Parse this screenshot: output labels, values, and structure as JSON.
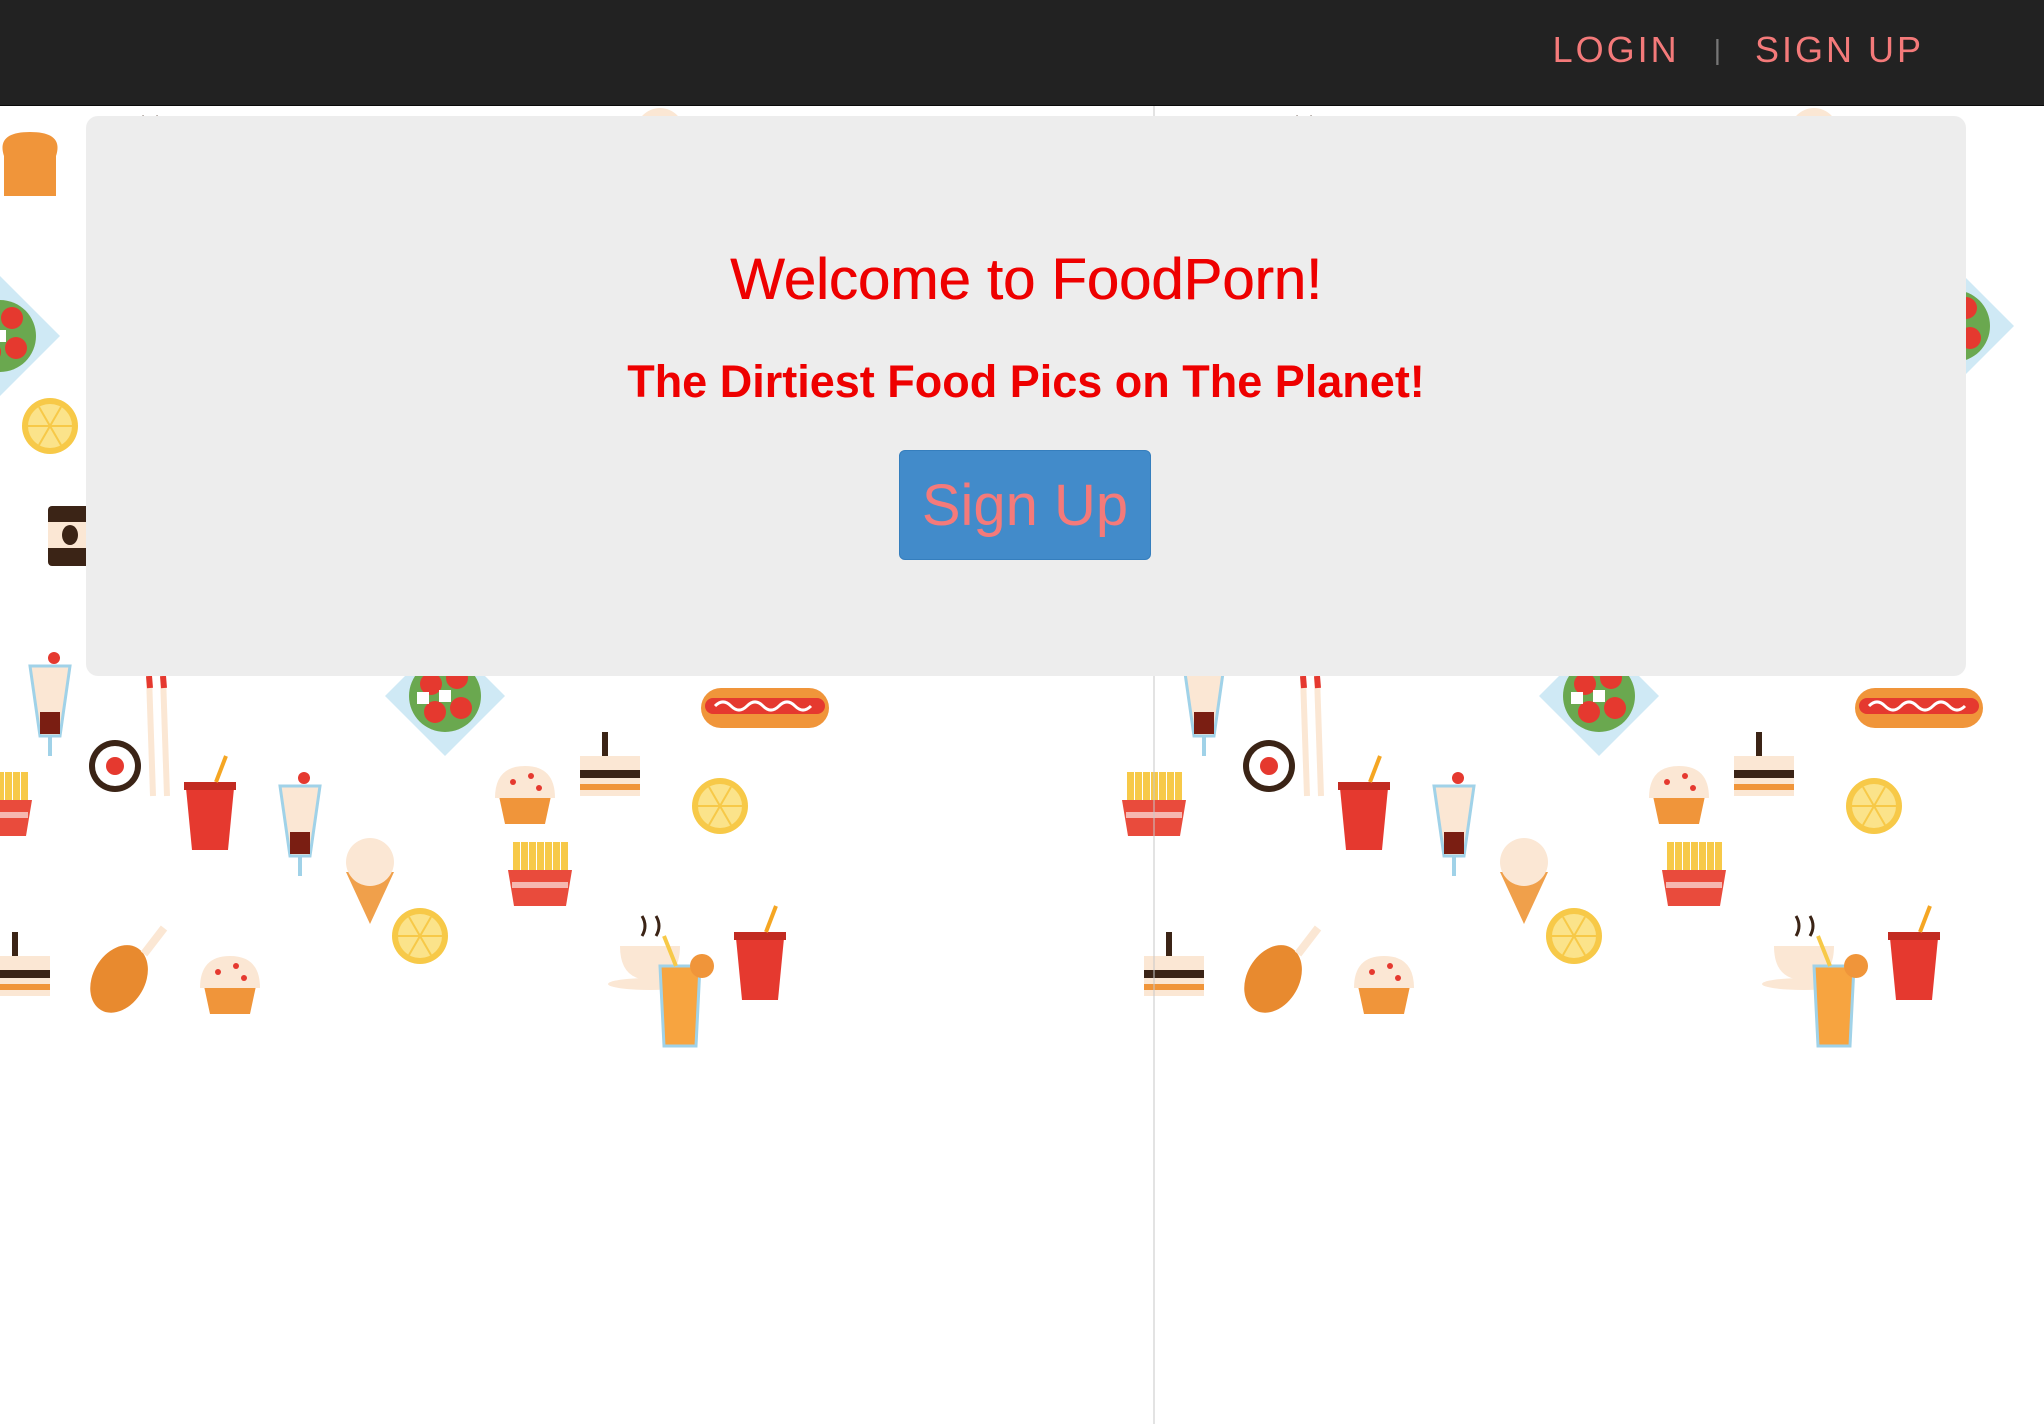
{
  "nav": {
    "login_label": "LOGIN",
    "separator": "|",
    "signup_label": "SIGN UP",
    "link_color": "#f47a7a",
    "bar_color": "#222222"
  },
  "hero": {
    "title": "Welcome to FoodPorn!",
    "subtitle": "The Dirtiest Food Pics on The Planet!",
    "signup_button_label": "Sign Up",
    "title_color": "#ee0000",
    "button_color": "#428bca"
  },
  "background": {
    "pattern_icons": [
      "burger-icon",
      "pizza-icon",
      "fries-icon",
      "soda-icon",
      "donut-icon",
      "sushi-icon",
      "hotdog-icon",
      "cupcake-icon",
      "ice-cream-icon",
      "coffee-icon",
      "lemon-icon",
      "ketchup-icon",
      "popcorn-icon",
      "salad-icon",
      "chicken-leg-icon",
      "milkshake-icon",
      "croissant-icon",
      "waffle-icon",
      "toast-icon",
      "cake-icon",
      "chopsticks-icon",
      "tea-cup-icon",
      "juice-icon"
    ]
  }
}
